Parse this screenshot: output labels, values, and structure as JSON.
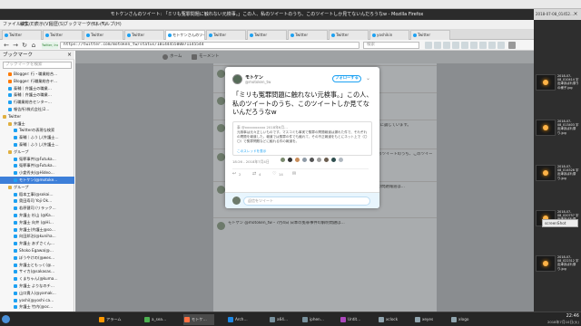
{
  "window": {
    "title": "モトケンさんのツイート: 「ミリも冤罪問題に触れない元検事。」この人、私のツイートのうち、このツイートしか見てないんだろうなw - Mozilla Firefox",
    "outer_title": "Xephyr - ファイルマネージャー"
  },
  "menu": [
    "ファイル(F)",
    "編集(E)",
    "表示(V)",
    "履歴(S)",
    "ブックマーク(B)",
    "ツール(T)",
    "ヘルプ(H)"
  ],
  "tabs": [
    {
      "label": "Twitter"
    },
    {
      "label": "Twitter"
    },
    {
      "label": "Twitter"
    },
    {
      "label": "Twitter"
    },
    {
      "label": "モトケンさんのツイート"
    },
    {
      "label": "Twitter"
    },
    {
      "label": "Twitter"
    },
    {
      "label": "Twitter"
    },
    {
      "label": "Twitter"
    },
    {
      "label": "yoshikin"
    },
    {
      "label": "Twitter"
    }
  ],
  "nav": {
    "back": "←",
    "forward": "→",
    "reload": "↻",
    "home": "⌂",
    "url": "https://twitter.com/motoken_tw/status/1014445500071145544",
    "url_site": "Twitter, Inc. (US)",
    "search_placeholder": "検索"
  },
  "sidebar": {
    "header": "ブックマーク",
    "close": "×",
    "search_placeholder": "ブックマークを検索",
    "items": [
      {
        "label": "Blogger: 行・職業総合…",
        "kind": "orange",
        "indent": 1
      },
      {
        "label": "Blogger: 行職業総合ヤ…",
        "kind": "orange",
        "indent": 1
      },
      {
        "label": "泰輔｜弁護士の職業…",
        "kind": "tw",
        "indent": 1
      },
      {
        "label": "泰輔｜弁護士の職業…",
        "kind": "tw",
        "indent": 1
      },
      {
        "label": "行職業総合センター…",
        "kind": "tw",
        "indent": 1
      },
      {
        "label": "報告所(株式会社)2…",
        "kind": "tw",
        "indent": 1
      },
      {
        "label": "Twitter",
        "kind": "folder",
        "indent": 0
      },
      {
        "label": "弁護士",
        "kind": "folder",
        "indent": 1
      },
      {
        "label": "Twitterの表現な検索",
        "kind": "tw",
        "indent": 2
      },
      {
        "label": "泰輔｜ふうし(弁護士…",
        "kind": "tw",
        "indent": 2
      },
      {
        "label": "泰輔｜ふうし(弁護士…",
        "kind": "tw",
        "indent": 2
      },
      {
        "label": "グループ",
        "kind": "folder",
        "indent": 1
      },
      {
        "label": "冤罪事件(@Futuka…",
        "kind": "tw",
        "indent": 2
      },
      {
        "label": "冤罪事件(@Futuka…",
        "kind": "tw",
        "indent": 2
      },
      {
        "label": "小倉秀夫(@Hideo…",
        "kind": "tw",
        "indent": 2
      },
      {
        "label": "モトケン(@motoke…",
        "kind": "tw",
        "indent": 2,
        "selected": true
      },
      {
        "label": "グループ",
        "kind": "folder",
        "indent": 1
      },
      {
        "label": "稲本工事(@sokai…",
        "kind": "tw",
        "indent": 2
      },
      {
        "label": "奥田寿司 Yoji Ok…",
        "kind": "tw",
        "indent": 2
      },
      {
        "label": "若原健司 (リラック…",
        "kind": "tw",
        "indent": 2
      },
      {
        "label": "弁護士 杉山 (@Ka…",
        "kind": "tw",
        "indent": 2
      },
      {
        "label": "弁護士 向井 (@Hi…",
        "kind": "tw",
        "indent": 2
      },
      {
        "label": "弁護士(弁護士@so…",
        "kind": "tw",
        "indent": 2
      },
      {
        "label": "向田邦治(@kuniha…",
        "kind": "tw",
        "indent": 2
      },
      {
        "label": "弁護士 あずさくん…",
        "kind": "tw",
        "indent": 2
      },
      {
        "label": "Shoko Egawa(@…",
        "kind": "tw",
        "indent": 2
      },
      {
        "label": "ぼうやけの(@wes…",
        "kind": "tw",
        "indent": 2
      },
      {
        "label": "弁護士ともっく(@…",
        "kind": "tw",
        "indent": 2
      },
      {
        "label": "サイカ(@sakasas…",
        "kind": "tw",
        "indent": 2
      },
      {
        "label": "くまちゃん(@kuma…",
        "kind": "tw",
        "indent": 2
      },
      {
        "label": "弁護士 よりなのチ…",
        "kind": "tw",
        "indent": 2
      },
      {
        "label": "山口貴人(@yamak…",
        "kind": "tw",
        "indent": 2
      },
      {
        "label": "yoshi(@yoshi ca…",
        "kind": "tw",
        "indent": 2
      },
      {
        "label": "弁護士 竹内(@oc…",
        "kind": "tw",
        "indent": 2
      },
      {
        "label": "自助編(ベテラン…",
        "kind": "tw",
        "indent": 2
      }
    ]
  },
  "twitter_nav": {
    "home": "ホーム",
    "moments": "モーメント"
  },
  "modal": {
    "name": "モトケン",
    "handle": "@motoken_tw",
    "follow_label": "フォローする",
    "caret": "⌄",
    "text": "「ミリも冤罪問題に触れない元検事。」この人、私のツイートのうち、このツイートしか見てないんだろうなw",
    "quote_head": "泰 @xxxxxxxxxx 2018年6月…",
    "quote_body": "元検事は元々正しいものです。マスコミも事実で冤罪の問題報道は漏れた件で、それぞれの問題を報道した。報道では冤罪の件でも触れて、その不正報道をもとにネット上で（〇〇）で冤罪問題などに触れる件の報道を。",
    "quote_link": "このスレッドを表示",
    "timestamp": "18:26 - 2018年7月4日",
    "reply_icon": "↩",
    "reply_count": "2",
    "retweet_icon": "⇄",
    "retweet_count": "4",
    "like_icon": "♡",
    "like_count": "14",
    "dm_icon": "✉",
    "reply_placeholder": "返信をツイート"
  },
  "feed": [
    {
      "text": "モトケン @motoken_tw・7月4日"
    },
    {
      "text": "Kazuho Hiraoka @sk#pluralize…"
    },
    {
      "text": "モトケン @motoken_tw・7月4日 返信先: @sokai3051さん 冤罪事件についてはまさに論じています。"
    },
    {
      "text": "モトケン @motoken_tw・7月4日 「ミリも冤罪問題に触れない元検事。」この人、私のツイートのうち、このツイートしか見てないんだろうなw"
    },
    {
      "text": "泰 @xxxxxxxxx 2018年6月… 元検事は元々正しいものです。マスコミも事実で冤罪の問題報道は…"
    },
    {
      "text": "モトケン @motoken_tw・7月4日 日本の冤罪事件の解明問題は…"
    }
  ],
  "filemanager": {
    "title": "2018-07-08_01452…",
    "close": "×",
    "items": [
      {
        "label": "2018-07-08_010414 宇出津あばれ祭りの様子.jpg"
      },
      {
        "label": "2018-07-08_013403 宇出津あばれ祭り.jpg"
      },
      {
        "label": "2018-07-08_014526 宇出津あばれ祭り.jpg"
      },
      {
        "label": "2018-07-08_020757 宇出津あばれ祭り.jpg"
      },
      {
        "label": "2018-07-08_022312 宇出津あばれ祭り.jpg"
      }
    ],
    "screenshot_label": "screenShot"
  },
  "taskbar": {
    "items": [
      {
        "label": "アラーム",
        "color": "#ff9800"
      },
      {
        "label": "a_sea…",
        "color": "#4caf50"
      },
      {
        "label": "モトケ…",
        "color": "#ff7043",
        "active": true
      },
      {
        "label": "Arch…",
        "color": "#1e88e5"
      },
      {
        "label": "a64…",
        "color": "#78909c"
      },
      {
        "label": "iphen…",
        "color": "#78909c"
      },
      {
        "label": "Untit…",
        "color": "#ab47bc"
      },
      {
        "label": "xclock",
        "color": "#90a4ae"
      },
      {
        "label": "xeyes",
        "color": "#90a4ae"
      },
      {
        "label": "xlogo",
        "color": "#90a4ae"
      }
    ],
    "time": "22:46",
    "date": "2018年7月10日(火)"
  },
  "colors": {
    "twitter_blue": "#1da1f2",
    "overlay": "#8a8d90",
    "selected": "#3d7fd9"
  }
}
